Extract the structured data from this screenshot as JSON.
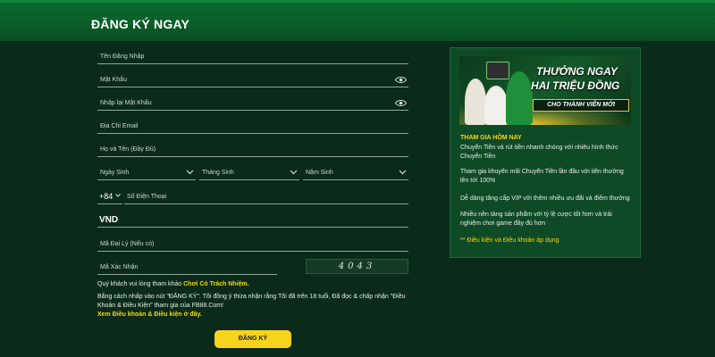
{
  "header": {
    "title": "ĐĂNG KÝ NGAY"
  },
  "form": {
    "username_placeholder": "Tên Đăng Nhập",
    "password_placeholder": "Mật Khẩu",
    "confirm_password_placeholder": "Nhập lại Mật Khẩu",
    "email_placeholder": "Địa Chỉ Email",
    "fullname_placeholder": "Họ và Tên (Đầy Đủ)",
    "birth_day": "Ngày Sinh",
    "birth_month": "Tháng Sinh",
    "birth_year": "Năm Sinh",
    "phone_code": "+84",
    "phone_placeholder": "Số Điện Thoại",
    "currency": "VND",
    "agent_code_placeholder": "Mã Đại Lý (Nếu có)",
    "captcha_placeholder": "Mã Xác Nhận",
    "captcha_code": "4043",
    "responsible_prefix": "Quý khách vui lòng tham khảo ",
    "responsible_link": "Chơi Có Trách Nhiệm.",
    "terms_text_1": "Bằng cách nhấp vào nút \"ĐĂNG KÝ\". Tôi đồng ý thừa nhận rằng Tôi đã trên 18 tuổi, Đã đọc & chấp nhận \"Điều",
    "terms_text_2": "Khoản & Điều Kiện\" tham gia của FB88.Com!",
    "terms_link": "Xem Điều khoản & Điều kiện ở đây.",
    "submit_label": "ĐĂNG KÝ"
  },
  "promo": {
    "banner_line1": "THƯỞNG NGAY",
    "banner_line2": "HAI TRIỆU ĐỒNG",
    "banner_line3": "CHO THÀNH VIÊN MỚI",
    "heading": "THAM GIA HÔM NAY",
    "items": [
      "Chuyển Tiền và rút tiền nhanh chóng với nhiều hình thức Chuyển Tiền",
      "Tham gia khuyến mãi Chuyển Tiền lần đầu với tiền thưởng lên tới 100%",
      "Dễ dàng tăng cấp VIP với thêm nhiều ưu đãi và điểm thưởng",
      "Nhiều nền tảng sản phẩm với tỷ lệ cược tốt hơn và trải nghiệm chơi game đầy đủ hơn"
    ],
    "footer": "** Điều kiện và Điều khoản áp dụng"
  },
  "colors": {
    "accent_yellow": "#f5d90a",
    "header_green": "#0b5c28",
    "panel_green": "#0f4a27",
    "background": "#0a2a1a"
  },
  "icons": [
    "eye-icon",
    "chevron-down-icon"
  ]
}
